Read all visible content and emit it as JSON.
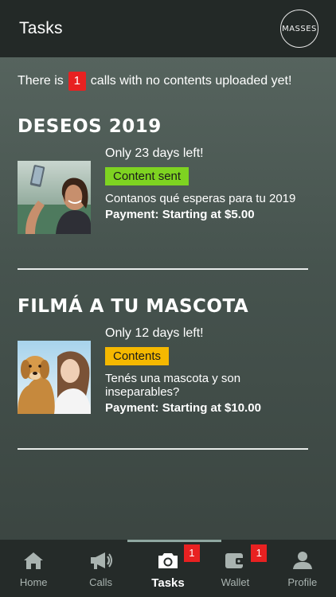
{
  "header": {
    "title": "Tasks",
    "logo_text": "MASSES"
  },
  "notice": {
    "prefix": "There is",
    "count": "1",
    "suffix": "calls with no contents uploaded yet!"
  },
  "tasks": [
    {
      "title": "DESEOS 2019",
      "days_left": "Only 23 days left!",
      "status": "Content sent",
      "status_color": "#7ed321",
      "description": "Contanos qué esperas para tu 2019",
      "payment": "Payment: Starting at $5.00"
    },
    {
      "title": "FILMÁ A TU MASCOTA",
      "days_left": "Only 12 days left!",
      "status": "Contents",
      "status_color": "#f5b800",
      "description": "Tenés una mascota y son inseparables?",
      "payment": "Payment: Starting at $10.00"
    }
  ],
  "tabbar": {
    "items": [
      {
        "label": "Home",
        "icon": "home-icon"
      },
      {
        "label": "Calls",
        "icon": "megaphone-icon"
      },
      {
        "label": "Tasks",
        "icon": "camera-icon",
        "badge": "1",
        "active": true
      },
      {
        "label": "Wallet",
        "icon": "wallet-icon",
        "badge": "1"
      },
      {
        "label": "Profile",
        "icon": "user-icon"
      }
    ]
  }
}
